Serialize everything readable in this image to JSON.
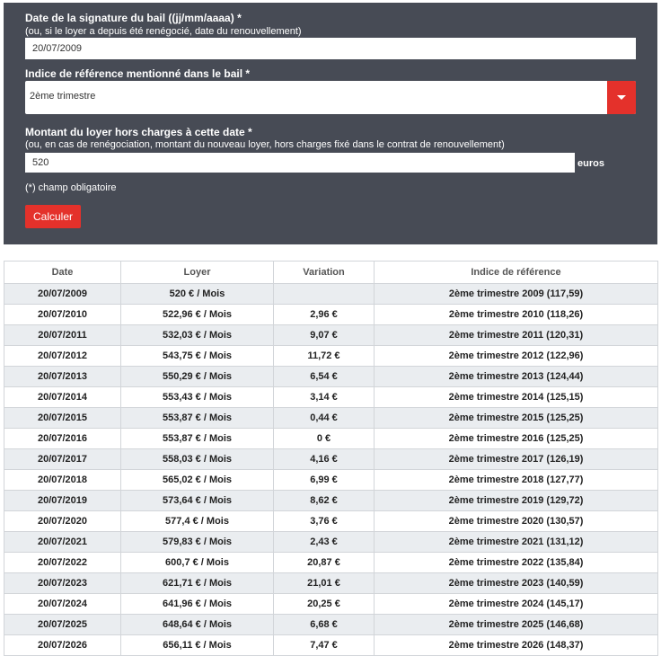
{
  "form": {
    "date_label": "Date de la signature du bail ((jj/mm/aaaa) *",
    "date_help": "(ou, si le loyer a depuis été renégocié, date du renouvellement)",
    "date_value": "20/07/2009",
    "index_label": "Indice de référence mentionné dans le bail *",
    "index_value": "2ème trimestre",
    "rent_label": "Montant du loyer hors charges à cette date *",
    "rent_help": "(ou, en cas de renégociation, montant du nouveau loyer, hors charges fixé dans le contrat de renouvellement)",
    "rent_value": "520",
    "rent_suffix": "euros",
    "required_note": "(*) champ obligatoire",
    "submit_label": "Calculer",
    "accent_color": "#e4312b",
    "panel_color": "#474b55"
  },
  "table": {
    "headers": [
      "Date",
      "Loyer",
      "Variation",
      "Indice de référence"
    ],
    "rows": [
      [
        "20/07/2009",
        "520 € / Mois",
        "",
        "2ème trimestre 2009 (117,59)"
      ],
      [
        "20/07/2010",
        "522,96 € / Mois",
        "2,96 €",
        "2ème trimestre 2010 (118,26)"
      ],
      [
        "20/07/2011",
        "532,03 € / Mois",
        "9,07 €",
        "2ème trimestre 2011 (120,31)"
      ],
      [
        "20/07/2012",
        "543,75 € / Mois",
        "11,72 €",
        "2ème trimestre 2012 (122,96)"
      ],
      [
        "20/07/2013",
        "550,29 € / Mois",
        "6,54 €",
        "2ème trimestre 2013 (124,44)"
      ],
      [
        "20/07/2014",
        "553,43 € / Mois",
        "3,14 €",
        "2ème trimestre 2014 (125,15)"
      ],
      [
        "20/07/2015",
        "553,87 € / Mois",
        "0,44 €",
        "2ème trimestre 2015 (125,25)"
      ],
      [
        "20/07/2016",
        "553,87 € / Mois",
        "0 €",
        "2ème trimestre 2016 (125,25)"
      ],
      [
        "20/07/2017",
        "558,03 € / Mois",
        "4,16 €",
        "2ème trimestre 2017 (126,19)"
      ],
      [
        "20/07/2018",
        "565,02 € / Mois",
        "6,99 €",
        "2ème trimestre 2018 (127,77)"
      ],
      [
        "20/07/2019",
        "573,64 € / Mois",
        "8,62 €",
        "2ème trimestre 2019 (129,72)"
      ],
      [
        "20/07/2020",
        "577,4 € / Mois",
        "3,76 €",
        "2ème trimestre 2020 (130,57)"
      ],
      [
        "20/07/2021",
        "579,83 € / Mois",
        "2,43 €",
        "2ème trimestre 2021 (131,12)"
      ],
      [
        "20/07/2022",
        "600,7 € / Mois",
        "20,87 €",
        "2ème trimestre 2022 (135,84)"
      ],
      [
        "20/07/2023",
        "621,71 € / Mois",
        "21,01 €",
        "2ème trimestre 2023 (140,59)"
      ],
      [
        "20/07/2024",
        "641,96 € / Mois",
        "20,25 €",
        "2ème trimestre 2024 (145,17)"
      ],
      [
        "20/07/2025",
        "648,64 € / Mois",
        "6,68 €",
        "2ème trimestre 2025 (146,68)"
      ],
      [
        "20/07/2026",
        "656,11 € / Mois",
        "7,47 €",
        "2ème trimestre 2026 (148,37)"
      ]
    ]
  }
}
